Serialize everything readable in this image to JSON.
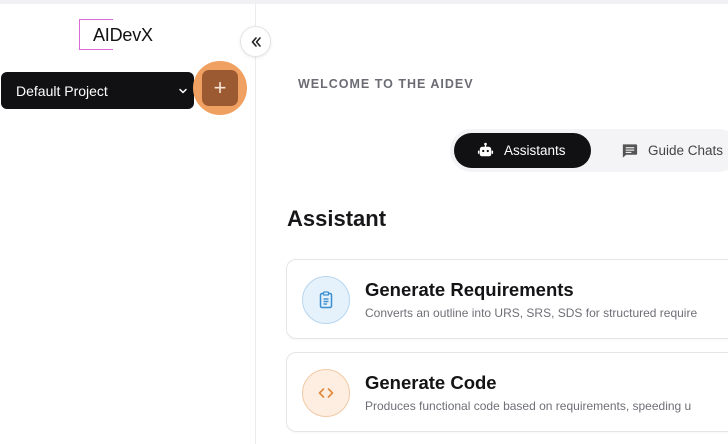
{
  "sidebar": {
    "logo_text": "AIDevX",
    "project_select_value": "Default Project",
    "add_button_label": "+"
  },
  "main": {
    "welcome_text": "WELCOME TO THE AIDEV",
    "tabs": [
      {
        "label": "Assistants",
        "icon": "robot-icon",
        "active": true
      },
      {
        "label": "Guide Chats",
        "icon": "chat-icon",
        "active": false
      }
    ],
    "section_title": "Assistant",
    "cards": [
      {
        "title": "Generate Requirements",
        "description": "Converts an outline into URS, SRS, SDS for structured require",
        "icon": "clipboard-icon",
        "accent": "#3a8fd0"
      },
      {
        "title": "Generate Code",
        "description": "Produces functional code based on requirements, speeding u",
        "icon": "code-icon",
        "accent": "#e08a3c"
      }
    ]
  },
  "colors": {
    "accent_orange": "#f0a060",
    "add_button": "#9b5a32",
    "dark": "#111113",
    "logo_border": "#d86bd7"
  }
}
